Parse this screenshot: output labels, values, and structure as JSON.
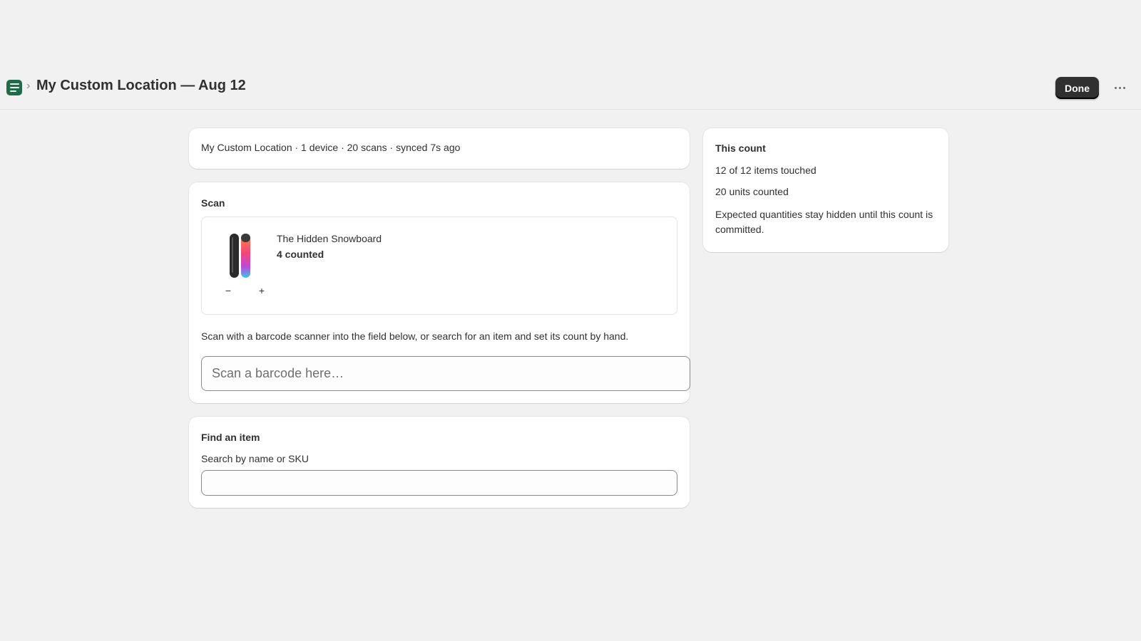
{
  "header": {
    "title": "My Custom Location — Aug 12",
    "breadcrumb_separator": "›",
    "done_label": "Done",
    "accent_color": "#1f6b4a"
  },
  "meta": {
    "summary": "My Custom Location · 1 device · 20 scans · synced 7s ago"
  },
  "scan": {
    "title": "Scan",
    "item": {
      "name": "The Hidden Snowboard",
      "count": "4 counted",
      "decrement_label": "−",
      "increment_label": "+"
    },
    "help_text": "Scan with a barcode scanner into the field below, or search for an item and set its count by hand.",
    "barcode_placeholder": "Scan a barcode here…",
    "barcode_value": ""
  },
  "find": {
    "title": "Find an item",
    "search_label": "Search by name or SKU",
    "search_value": ""
  },
  "count_summary": {
    "title": "This count",
    "items_touched": "12 of 12 items touched",
    "units_counted": "20 units counted",
    "note": "Expected quantities stay hidden until this count is committed."
  },
  "icons": [
    "list-icon",
    "chevron-right-icon",
    "more-horizontal-icon"
  ]
}
